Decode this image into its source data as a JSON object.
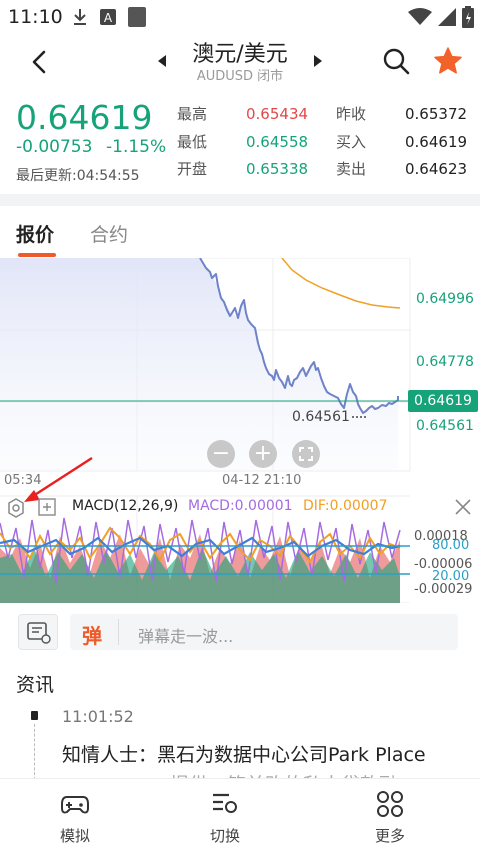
{
  "status_bar": {
    "time": "11:10"
  },
  "header": {
    "title": "澳元/美元",
    "subtitle": "AUDUSD 闭市"
  },
  "quote": {
    "price": "0.64619",
    "change": "-0.00753",
    "change_pct": "-1.15%",
    "updated": "最后更新:04:54:55",
    "stats": {
      "high_label": "最高",
      "high": "0.65434",
      "low_label": "最低",
      "low": "0.64558",
      "open_label": "开盘",
      "open": "0.65338",
      "prev_close_label": "昨收",
      "prev_close": "0.65372",
      "buy_label": "买入",
      "buy": "0.64619",
      "sell_label": "卖出",
      "sell": "0.64623"
    }
  },
  "tabs": [
    {
      "label": "报价",
      "active": true
    },
    {
      "label": "合约",
      "active": false
    }
  ],
  "chart": {
    "axis_prices": [
      "0.64996",
      "0.64778",
      "0.64619",
      "0.64561"
    ],
    "low_marker": "0.64561",
    "time_left": "05:34",
    "time_center": "04-12 21:10",
    "zoom_out": "−",
    "zoom_in": "+",
    "colors": {
      "line": "#6f83c9",
      "ma": "#f0a024",
      "up": "#17a37a",
      "down": "#e34848"
    }
  },
  "macd": {
    "title": "MACD(12,26,9)",
    "macd_value": "MACD:0.00001",
    "dif_value": "DIF:0.00007",
    "axis": [
      "0.00018",
      "80.00",
      "-0.00006",
      "20.00",
      "-0.00029"
    ]
  },
  "danmaku": {
    "logo": "弹",
    "placeholder": "弹幕走一波..."
  },
  "news": {
    "heading": "资讯",
    "items": [
      {
        "time": "11:01:52",
        "text": "知情人士：黑石为数据中心公司Park Place",
        "text_cont": "提供一笔并购的私人贷款融"
      }
    ]
  },
  "bottom_nav": [
    {
      "label": "模拟",
      "icon": "gamepad-icon"
    },
    {
      "label": "切换",
      "icon": "switch-icon"
    },
    {
      "label": "更多",
      "icon": "more-icon"
    }
  ]
}
